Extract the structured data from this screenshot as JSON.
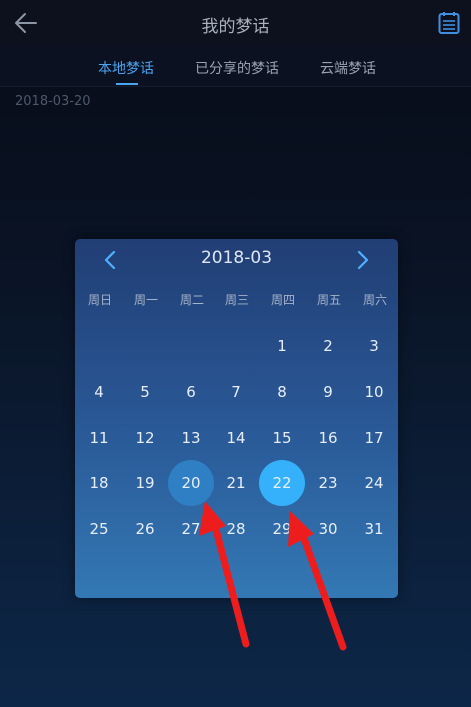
{
  "header": {
    "title": "我的梦话",
    "back_icon": "arrow-left-icon",
    "calendar_icon": "calendar-icon"
  },
  "tabs": [
    {
      "label": "本地梦话",
      "active": true
    },
    {
      "label": "已分享的梦话",
      "active": false
    },
    {
      "label": "云端梦话",
      "active": false
    }
  ],
  "list": {
    "date": "2018-03-20"
  },
  "calendar": {
    "month": "2018-03",
    "prev_icon": "chevron-left-icon",
    "next_icon": "chevron-right-icon",
    "weekdays": [
      "周日",
      "周一",
      "周二",
      "周三",
      "周四",
      "周五",
      "周六"
    ],
    "first_weekday_index": 4,
    "days_in_month": 31,
    "highlighted_days": [
      20,
      22
    ],
    "selected_day": 22
  },
  "colors": {
    "accent": "#4aa4f0",
    "highlight_day": "#2f7fc4",
    "selected_day": "#35b1fb",
    "annotation_arrow": "#ee1d1d"
  }
}
